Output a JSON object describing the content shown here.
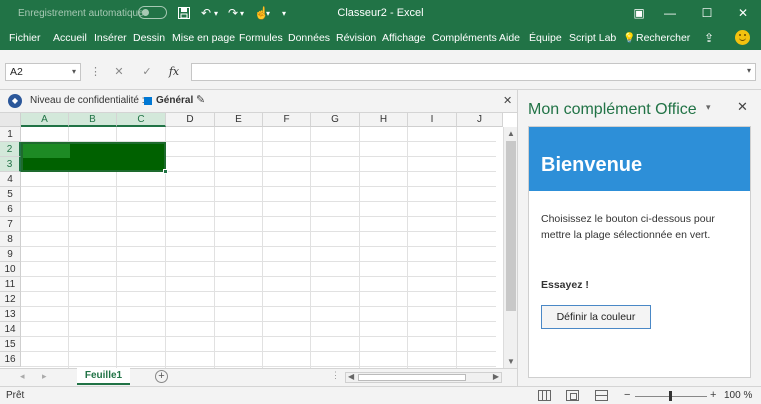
{
  "titlebar": {
    "autosave_label": "Enregistrement automatique",
    "save_icon": "save-icon",
    "undo_glyph": "↶",
    "redo_glyph": "↷",
    "touch_glyph": "☝",
    "dropdown_glyph": "▾",
    "title": "Classeur2 - Excel",
    "ribbon_display_glyph": "▣",
    "minimize_glyph": "—",
    "maximize_glyph": "☐",
    "close_glyph": "✕"
  },
  "ribbon": {
    "tabs": [
      "Fichier",
      "Accueil",
      "Insérer",
      "Dessin",
      "Mise en page",
      "Formules",
      "Données",
      "Révision",
      "Affichage",
      "Compléments",
      "Aide",
      "Équipe",
      "Script Lab"
    ],
    "search_label": "Rechercher",
    "search_glyph": "💡",
    "share_glyph": "⇪"
  },
  "formula_bar": {
    "name_box_value": "A2",
    "dropdown_glyph": "▾",
    "dots_glyph": "⋮",
    "cancel_glyph": "✕",
    "enter_glyph": "✓",
    "fx_label": "fx",
    "formula_value": ""
  },
  "sensitivity": {
    "tag_glyph": "◆",
    "label": "Niveau de confidentialité :",
    "value": "Général",
    "pencil_glyph": "✎",
    "close_glyph": "✕"
  },
  "grid": {
    "columns": [
      "A",
      "B",
      "C",
      "D",
      "E",
      "F",
      "G",
      "H",
      "I",
      "J"
    ],
    "rows": [
      "1",
      "2",
      "3",
      "4",
      "5",
      "6",
      "7",
      "8",
      "9",
      "10",
      "11",
      "12",
      "13",
      "14",
      "15",
      "16"
    ],
    "selected_range_color": "#006100",
    "active_cell_color": "#1d8a24"
  },
  "sheets": {
    "tabs": [
      "Feuille1"
    ],
    "prev_glyph": "◂",
    "next_glyph": "▸",
    "add_glyph": "+",
    "dots_glyph": "⋮"
  },
  "task_pane": {
    "title": "Mon complément Office",
    "dropdown_glyph": "▾",
    "close_glyph": "✕",
    "banner_title": "Bienvenue",
    "description": "Choisissez le bouton ci-dessous pour mettre la plage sélectionnée en vert.",
    "try_label": "Essayez !",
    "button_label": "Définir la couleur",
    "banner_color": "#2d8fd8"
  },
  "status": {
    "ready_label": "Prêt",
    "zoom_minus": "−",
    "zoom_plus": "+",
    "zoom_label": "100 %"
  },
  "colors": {
    "excel_green": "#217346",
    "accent_blue": "#2b579a"
  }
}
